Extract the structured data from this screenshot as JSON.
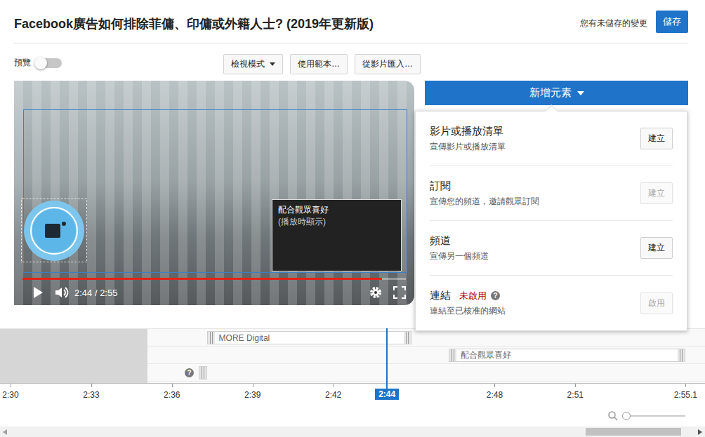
{
  "header": {
    "title": "Facebook廣告如何排除菲傭、印傭或外籍人士? (2019年更新版)",
    "unsaved": "您有未儲存的變更",
    "save": "儲存"
  },
  "toolbar": {
    "preview": {
      "label": "預覽",
      "on": false
    },
    "buttons": [
      {
        "label": "檢視模式",
        "dropdown": true
      },
      {
        "label": "使用範本…",
        "dropdown": false
      },
      {
        "label": "從影片匯入…",
        "dropdown": false
      }
    ]
  },
  "player": {
    "time": "2:44 / 2:55",
    "progress": 0.937,
    "elements": [
      {
        "kind": "subscribe",
        "title": "",
        "note": ""
      },
      {
        "kind": "video",
        "title": "配合觀眾喜好",
        "note": "(播放時顯示)"
      }
    ]
  },
  "add_element": {
    "label": "新增元素",
    "open": true,
    "items": [
      {
        "title": "影片或播放清單",
        "status": "",
        "help": "",
        "desc": "宣傳影片或播放清單",
        "action": "建立",
        "disabled": false
      },
      {
        "title": "訂閱",
        "status": "",
        "help": "",
        "desc": "宣傳您的頻道，邀請觀眾訂閱",
        "action": "建立",
        "disabled": true
      },
      {
        "title": "頻道",
        "status": "",
        "help": "",
        "desc": "宣傳另一個頻道",
        "action": "建立",
        "disabled": false
      },
      {
        "title": "連結",
        "status": "未啟用",
        "help": "?",
        "desc": "連結至已核准的網站",
        "action": "啟用",
        "disabled": true
      }
    ]
  },
  "timeline": {
    "locked_until": 155.1,
    "help": "?",
    "tracks": [
      {
        "label": "MORE Digital",
        "start": 157.3,
        "end": 164.9
      },
      {
        "label": "配合觀眾喜好",
        "start": 166.3,
        "end": 175.1
      },
      {
        "label": "",
        "start": 157.0,
        "end": 157.3
      }
    ],
    "ticks": [
      "2:30",
      "2:33",
      "2:36",
      "2:39",
      "2:42",
      "2:48",
      "2:51",
      "2:55.1"
    ],
    "playhead": "2:44"
  },
  "zoom": {
    "level": 0.05
  },
  "scrollbar": {
    "start": 0.84,
    "size": 0.14
  }
}
